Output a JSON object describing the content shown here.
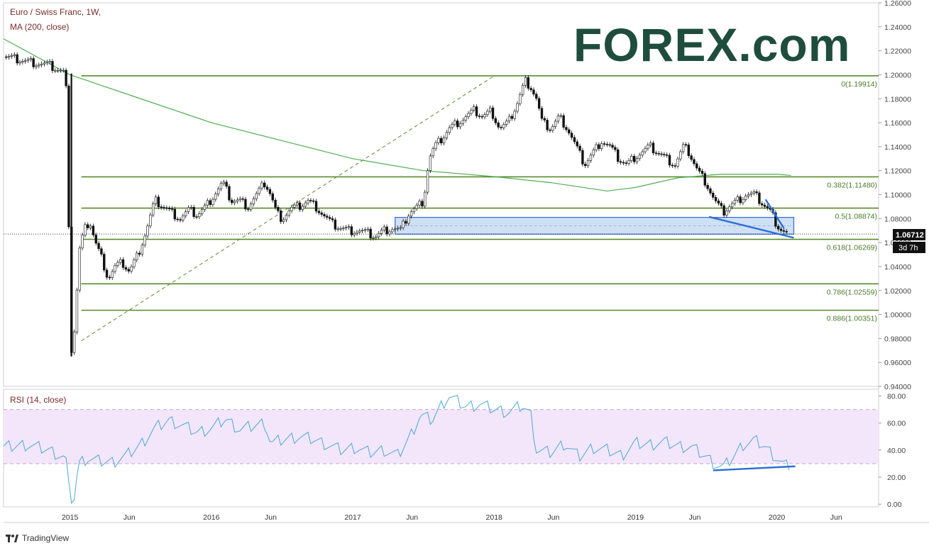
{
  "header": {
    "symbol_title": "Euro / Swiss Franc, 1W,",
    "ma_label": "MA (200, close)",
    "rsi_label": "RSI (14, close)"
  },
  "brand": {
    "forex_logo": "FOREX.com",
    "tradingview": "TradingView"
  },
  "price_badge": {
    "value": "1.06712",
    "countdown": "3d 7h"
  },
  "colors": {
    "candle": "#111111",
    "ma": "#4caf50",
    "fib": "#5a8a2a",
    "blue": "#2b6fd6",
    "zone": "#cfe0f5",
    "rsi_band": "#f3e6fb",
    "rsi_line": "#4aa8d8",
    "logo": "#1f4d3d"
  },
  "chart_data": [
    {
      "type": "candlestick",
      "title": "Euro / Swiss Franc, 1W,",
      "indicator": "MA (200, close)",
      "ylim": [
        0.94,
        1.26
      ],
      "y_ticks": [
        "1.26000",
        "1.24000",
        "1.22000",
        "1.20000",
        "1.18000",
        "1.16000",
        "1.14000",
        "1.12000",
        "1.10000",
        "1.08000",
        "1.06000",
        "1.04000",
        "1.02000",
        "1.00000",
        "0.98000",
        "0.96000",
        "0.94000"
      ],
      "x_ticks": [
        "2015",
        "Jun",
        "2016",
        "Jun",
        "2017",
        "Jun",
        "2018",
        "Jun",
        "2019",
        "Jun",
        "2020",
        "Jun"
      ],
      "x_tick_pos": [
        2015.0,
        2015.42,
        2016.0,
        2016.42,
        2017.0,
        2017.42,
        2018.0,
        2018.42,
        2019.0,
        2019.42,
        2020.0,
        2020.42
      ],
      "xlim": [
        2014.53,
        2020.72
      ],
      "closes_path": [
        [
          2014.53,
          1.215
        ],
        [
          2014.7,
          1.211
        ],
        [
          2014.85,
          1.208
        ],
        [
          2014.97,
          1.201
        ],
        [
          2015.01,
          0.97
        ],
        [
          2015.04,
          0.995
        ],
        [
          2015.06,
          1.05
        ],
        [
          2015.1,
          1.07
        ],
        [
          2015.14,
          1.078
        ],
        [
          2015.18,
          1.06
        ],
        [
          2015.23,
          1.045
        ],
        [
          2015.27,
          1.03
        ],
        [
          2015.32,
          1.04
        ],
        [
          2015.37,
          1.043
        ],
        [
          2015.42,
          1.036
        ],
        [
          2015.48,
          1.05
        ],
        [
          2015.54,
          1.07
        ],
        [
          2015.6,
          1.095
        ],
        [
          2015.66,
          1.09
        ],
        [
          2015.72,
          1.085
        ],
        [
          2015.78,
          1.08
        ],
        [
          2015.84,
          1.087
        ],
        [
          2015.9,
          1.083
        ],
        [
          2015.96,
          1.09
        ],
        [
          2016.02,
          1.1
        ],
        [
          2016.08,
          1.11
        ],
        [
          2016.14,
          1.095
        ],
        [
          2016.2,
          1.095
        ],
        [
          2016.26,
          1.09
        ],
        [
          2016.32,
          1.1
        ],
        [
          2016.38,
          1.11
        ],
        [
          2016.42,
          1.1
        ],
        [
          2016.46,
          1.085
        ],
        [
          2016.5,
          1.08
        ],
        [
          2016.56,
          1.088
        ],
        [
          2016.62,
          1.09
        ],
        [
          2016.68,
          1.095
        ],
        [
          2016.74,
          1.09
        ],
        [
          2016.8,
          1.082
        ],
        [
          2016.86,
          1.075
        ],
        [
          2016.92,
          1.072
        ],
        [
          2016.98,
          1.07
        ],
        [
          2017.04,
          1.07
        ],
        [
          2017.1,
          1.068
        ],
        [
          2017.16,
          1.065
        ],
        [
          2017.22,
          1.07
        ],
        [
          2017.28,
          1.072
        ],
        [
          2017.34,
          1.07
        ],
        [
          2017.4,
          1.085
        ],
        [
          2017.46,
          1.09
        ],
        [
          2017.5,
          1.095
        ],
        [
          2017.54,
          1.13
        ],
        [
          2017.58,
          1.14
        ],
        [
          2017.62,
          1.145
        ],
        [
          2017.68,
          1.155
        ],
        [
          2017.74,
          1.16
        ],
        [
          2017.8,
          1.165
        ],
        [
          2017.86,
          1.17
        ],
        [
          2017.92,
          1.165
        ],
        [
          2017.98,
          1.17
        ],
        [
          2018.04,
          1.155
        ],
        [
          2018.1,
          1.16
        ],
        [
          2018.16,
          1.175
        ],
        [
          2018.22,
          1.195
        ],
        [
          2018.26,
          1.19
        ],
        [
          2018.3,
          1.18
        ],
        [
          2018.34,
          1.16
        ],
        [
          2018.4,
          1.155
        ],
        [
          2018.46,
          1.165
        ],
        [
          2018.52,
          1.155
        ],
        [
          2018.58,
          1.14
        ],
        [
          2018.64,
          1.125
        ],
        [
          2018.7,
          1.135
        ],
        [
          2018.76,
          1.145
        ],
        [
          2018.82,
          1.14
        ],
        [
          2018.88,
          1.13
        ],
        [
          2018.94,
          1.125
        ],
        [
          2018.98,
          1.13
        ],
        [
          2019.04,
          1.135
        ],
        [
          2019.1,
          1.14
        ],
        [
          2019.16,
          1.135
        ],
        [
          2019.22,
          1.13
        ],
        [
          2019.28,
          1.125
        ],
        [
          2019.34,
          1.14
        ],
        [
          2019.38,
          1.135
        ],
        [
          2019.44,
          1.12
        ],
        [
          2019.5,
          1.11
        ],
        [
          2019.56,
          1.095
        ],
        [
          2019.62,
          1.085
        ],
        [
          2019.66,
          1.09
        ],
        [
          2019.72,
          1.095
        ],
        [
          2019.78,
          1.1
        ],
        [
          2019.84,
          1.1
        ],
        [
          2019.88,
          1.095
        ],
        [
          2019.92,
          1.09
        ],
        [
          2019.96,
          1.085
        ],
        [
          2020.0,
          1.075
        ],
        [
          2020.04,
          1.07
        ],
        [
          2020.08,
          1.0671
        ]
      ],
      "ma200_path": [
        [
          2014.53,
          1.23
        ],
        [
          2015.0,
          1.2
        ],
        [
          2015.5,
          1.18
        ],
        [
          2016.0,
          1.16
        ],
        [
          2016.5,
          1.145
        ],
        [
          2017.0,
          1.13
        ],
        [
          2017.5,
          1.12
        ],
        [
          2018.0,
          1.115
        ],
        [
          2018.4,
          1.11
        ],
        [
          2018.8,
          1.103
        ],
        [
          2019.0,
          1.106
        ],
        [
          2019.3,
          1.114
        ],
        [
          2019.6,
          1.117
        ],
        [
          2020.0,
          1.117
        ],
        [
          2020.1,
          1.116
        ]
      ],
      "fib_levels": [
        {
          "label": "0(1.19914)",
          "value": 1.19914
        },
        {
          "label": "0.382(1.11480)",
          "value": 1.1148
        },
        {
          "label": "0.5(1.08874)",
          "value": 1.08874
        },
        {
          "label": "0.618(1.06269)",
          "value": 1.06269
        },
        {
          "label": "0.786(1.02559)",
          "value": 1.02559
        },
        {
          "label": "0.886(1.00351)",
          "value": 1.00351
        }
      ],
      "fib_start": 2015.08,
      "support_zone": {
        "x": [
          2017.3,
          2020.12
        ],
        "y": [
          1.067,
          1.081
        ]
      },
      "fib_dashed_line": [
        [
          2015.08,
          0.978
        ],
        [
          2018.0,
          1.199
        ]
      ],
      "blue_lines": [
        [
          [
            2019.52,
            1.0815
          ],
          [
            2020.12,
            1.064
          ]
        ],
        [
          [
            2019.92,
            1.096
          ],
          [
            2020.05,
            1.072
          ]
        ]
      ],
      "last_price": 1.06712
    },
    {
      "type": "line",
      "title": "RSI (14, close)",
      "ylim": [
        -2,
        85
      ],
      "y_ticks": [
        "80.00",
        "60.00",
        "40.00",
        "20.00",
        "0.00"
      ],
      "band": [
        30,
        70
      ],
      "values_path": [
        [
          2014.53,
          42
        ],
        [
          2014.7,
          44
        ],
        [
          2014.85,
          40
        ],
        [
          2014.97,
          34
        ],
        [
          2015.0,
          4
        ],
        [
          2015.03,
          5
        ],
        [
          2015.06,
          30
        ],
        [
          2015.12,
          34
        ],
        [
          2015.2,
          32
        ],
        [
          2015.3,
          31
        ],
        [
          2015.4,
          36
        ],
        [
          2015.5,
          44
        ],
        [
          2015.6,
          56
        ],
        [
          2015.7,
          62
        ],
        [
          2015.8,
          58
        ],
        [
          2015.9,
          53
        ],
        [
          2016.0,
          56
        ],
        [
          2016.1,
          63
        ],
        [
          2016.2,
          55
        ],
        [
          2016.3,
          58
        ],
        [
          2016.38,
          60
        ],
        [
          2016.42,
          45
        ],
        [
          2016.52,
          48
        ],
        [
          2016.62,
          50
        ],
        [
          2016.72,
          48
        ],
        [
          2016.82,
          44
        ],
        [
          2016.92,
          40
        ],
        [
          2017.02,
          42
        ],
        [
          2017.12,
          38
        ],
        [
          2017.22,
          40
        ],
        [
          2017.32,
          36
        ],
        [
          2017.4,
          49
        ],
        [
          2017.48,
          66
        ],
        [
          2017.56,
          62
        ],
        [
          2017.62,
          72
        ],
        [
          2017.68,
          80
        ],
        [
          2017.74,
          76
        ],
        [
          2017.8,
          72
        ],
        [
          2017.9,
          74
        ],
        [
          2018.0,
          70
        ],
        [
          2018.1,
          68
        ],
        [
          2018.2,
          73
        ],
        [
          2018.26,
          66
        ],
        [
          2018.3,
          40
        ],
        [
          2018.4,
          38
        ],
        [
          2018.5,
          45
        ],
        [
          2018.6,
          35
        ],
        [
          2018.7,
          42
        ],
        [
          2018.8,
          40
        ],
        [
          2018.9,
          36
        ],
        [
          2019.0,
          45
        ],
        [
          2019.1,
          44
        ],
        [
          2019.2,
          46
        ],
        [
          2019.3,
          43
        ],
        [
          2019.4,
          42
        ],
        [
          2019.5,
          35
        ],
        [
          2019.56,
          30
        ],
        [
          2019.62,
          27
        ],
        [
          2019.7,
          36
        ],
        [
          2019.76,
          44
        ],
        [
          2019.84,
          47
        ],
        [
          2019.9,
          44
        ],
        [
          2019.96,
          38
        ],
        [
          2020.02,
          32
        ],
        [
          2020.06,
          28
        ],
        [
          2020.1,
          29
        ]
      ],
      "divergence_line": [
        [
          2019.55,
          25
        ],
        [
          2020.13,
          28
        ]
      ]
    }
  ]
}
